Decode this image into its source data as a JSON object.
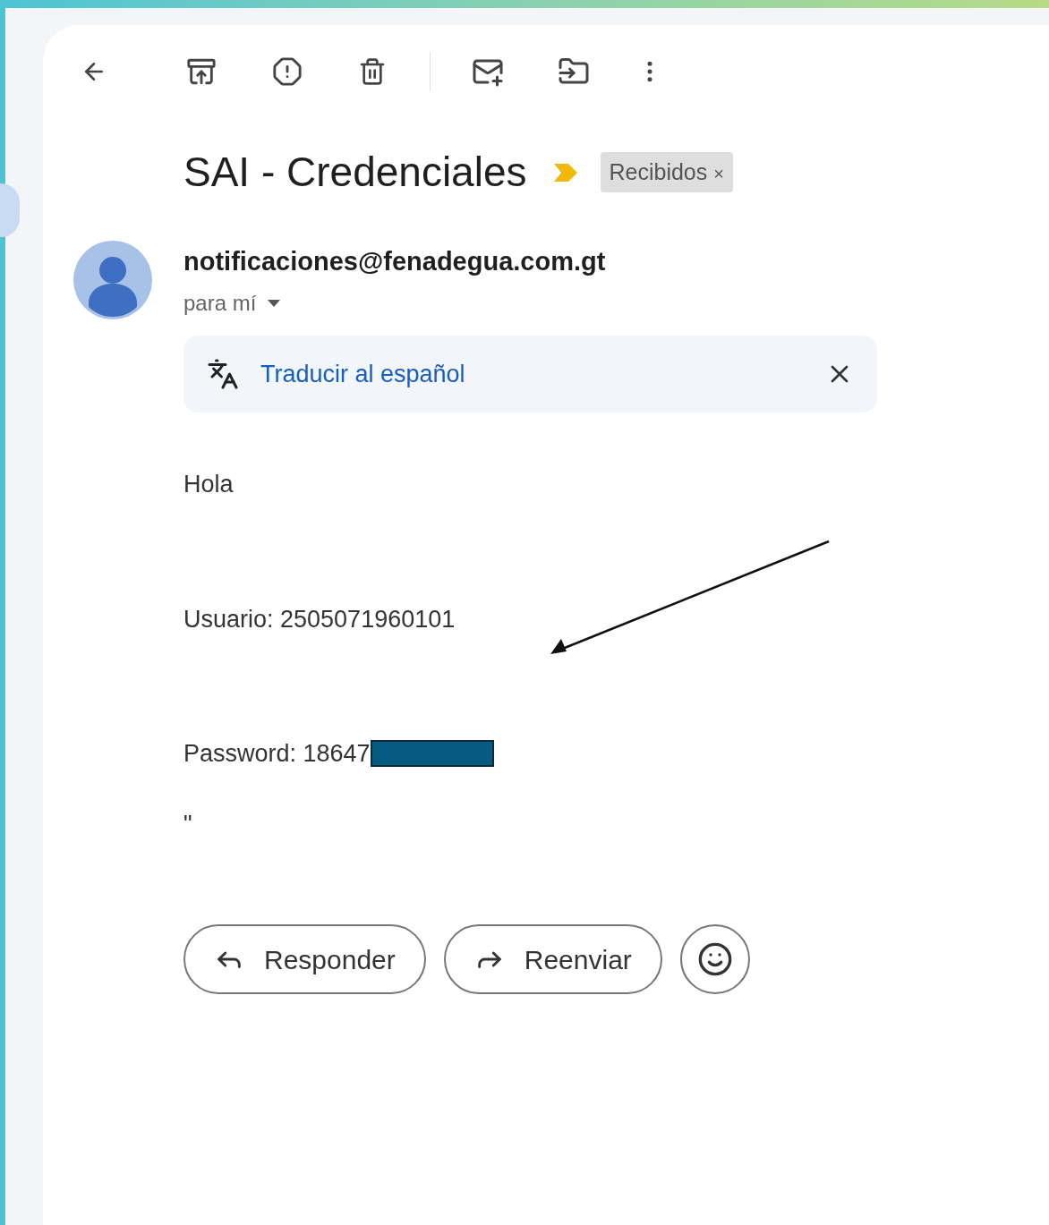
{
  "subject": "SAI - Credenciales",
  "important": true,
  "label": {
    "text": "Recibidos",
    "close": "×"
  },
  "sender": {
    "email": "notificaciones@fenadegua.com.gt",
    "recipient": "para mí"
  },
  "translate": {
    "link": "Traducir al español"
  },
  "body": [
    {
      "kind": "text",
      "text": "Hola"
    },
    {
      "kind": "text",
      "text": "Usuario: 2505071960101"
    },
    {
      "kind": "redacted",
      "text": "Password: 18647"
    },
    {
      "kind": "text",
      "text": "\""
    }
  ],
  "buttons": [
    {
      "kind": "reply",
      "label": "Responder"
    },
    {
      "kind": "forward",
      "label": "Reenviar"
    },
    {
      "kind": "emoji"
    }
  ]
}
